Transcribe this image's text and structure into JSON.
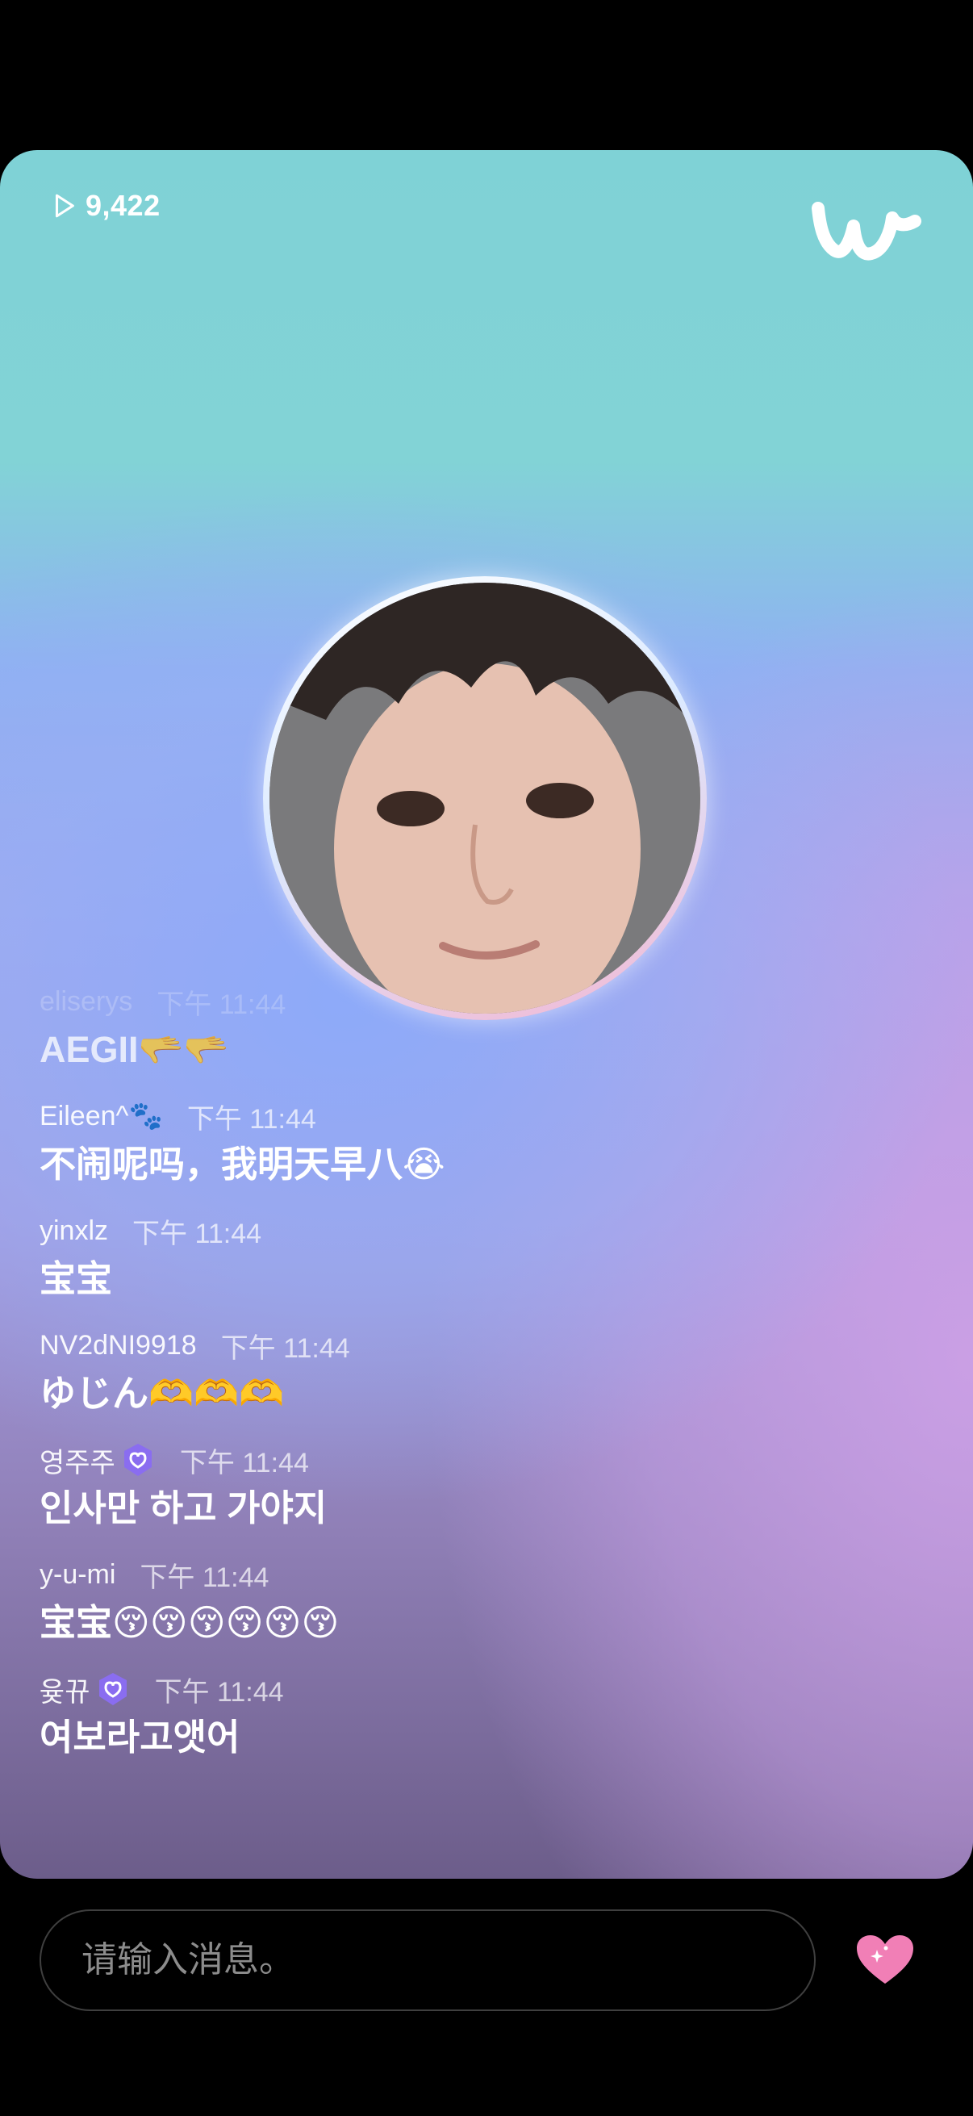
{
  "stream": {
    "view_count": "9,422"
  },
  "chat": {
    "messages": [
      {
        "user": "eliserys",
        "time": "下午 11:44",
        "text": "AEGII🫳🫳",
        "verified": false
      },
      {
        "user": "Eileen^🐾",
        "time": "下午 11:44",
        "text": "不闹呢吗，我明天早八😭",
        "verified": false
      },
      {
        "user": "yinxlz",
        "time": "下午 11:44",
        "text": "宝宝",
        "verified": false
      },
      {
        "user": "NV2dNI9918",
        "time": "下午 11:44",
        "text": "ゆじん🫶🫶🫶",
        "verified": false
      },
      {
        "user": "영주주",
        "time": "下午 11:44",
        "text": "인사만 하고 가야지",
        "verified": true
      },
      {
        "user": "y-u-mi",
        "time": "下午 11:44",
        "text": "宝宝😚😚😚😚😚😚",
        "verified": false
      },
      {
        "user": "윶뀨",
        "time": "下午 11:44",
        "text": "여보라고앳어",
        "verified": true
      }
    ]
  },
  "input": {
    "placeholder": "请输入消息。"
  },
  "icons": {
    "views": "play-icon",
    "logo": "weverse-logo",
    "badge": "verified-badge-icon",
    "like": "heart-icon"
  },
  "colors": {
    "background": "#000000",
    "heart": "#f17fb6",
    "badge": "#8a6df0"
  }
}
